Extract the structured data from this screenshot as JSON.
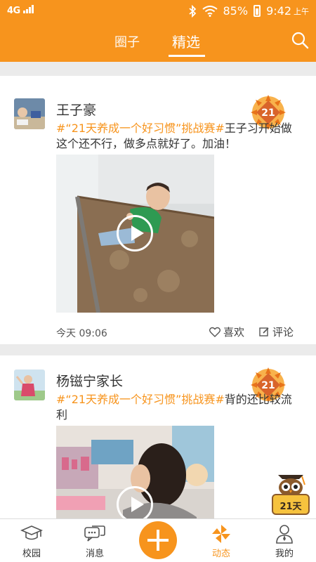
{
  "status_bar": {
    "network": "4G",
    "battery": "85%",
    "time": "9:42",
    "ampm": "上午"
  },
  "header": {
    "tabs": [
      {
        "label": "圈子"
      },
      {
        "label": "精选"
      }
    ],
    "search_icon": "search-icon",
    "accent": "#f7941d"
  },
  "posts": [
    {
      "author": "王子豪",
      "hashtag": "#“21天养成一个好习惯”挑战赛#",
      "text": "王子习开始做这个还不行，做多点就好了。加油！",
      "timestamp": "今天 09:06",
      "like_label": "喜欢",
      "comment_label": "评论"
    },
    {
      "author": "杨镃宁家长",
      "hashtag": "#“21天养成一个好习惯”挑战赛#",
      "text": "背的还比较流利"
    }
  ],
  "floater": {
    "label": "21天"
  },
  "bottom_nav": [
    {
      "label": "校园",
      "icon": "graduation-cap-icon"
    },
    {
      "label": "消息",
      "icon": "chat-bubbles-icon"
    },
    {
      "label": "",
      "icon": "plus-icon"
    },
    {
      "label": "动态",
      "icon": "pinwheel-icon"
    },
    {
      "label": "我的",
      "icon": "person-icon"
    }
  ]
}
